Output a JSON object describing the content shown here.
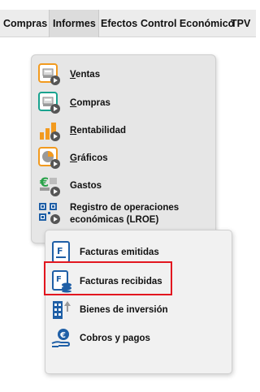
{
  "menubar": {
    "items": [
      "Compras",
      "Informes",
      "Efectos",
      "Control Económico",
      "TPV"
    ]
  },
  "informes_menu": {
    "items": [
      {
        "accel": "V",
        "rest": "entas",
        "icon": "sales-report-icon"
      },
      {
        "accel": "C",
        "rest": "ompras",
        "icon": "purchases-report-icon"
      },
      {
        "accel": "R",
        "rest": "entabilidad",
        "icon": "profitability-bars-icon"
      },
      {
        "accel": "G",
        "rest": "ráficos",
        "icon": "pie-chart-icon"
      },
      {
        "accel": "",
        "rest": "Gastos",
        "icon": "euro-expenses-icon"
      },
      {
        "line1": "Registro de operaciones",
        "line2": "económicas (LROE)",
        "icon": "qr-code-icon"
      }
    ]
  },
  "submenu": {
    "items": [
      {
        "label": "Facturas emitidas",
        "icon": "invoice-issued-icon"
      },
      {
        "label": "Facturas recibidas",
        "icon": "invoice-received-icon"
      },
      {
        "label": "Bienes de inversión",
        "icon": "building-investment-icon"
      },
      {
        "label": "Cobros y pagos",
        "icon": "hand-euro-coin-icon"
      }
    ],
    "highlighted_index": 1
  },
  "colors": {
    "menubar_bg": "#ececec",
    "dropdown_bg": "#e6e6e6",
    "submenu_bg": "#f1f1f1",
    "highlight": "#e2161f",
    "icon_blue": "#1f5fa6",
    "icon_orange": "#f29a1f",
    "icon_teal": "#1aa38f",
    "icon_green": "#2aa24a"
  }
}
